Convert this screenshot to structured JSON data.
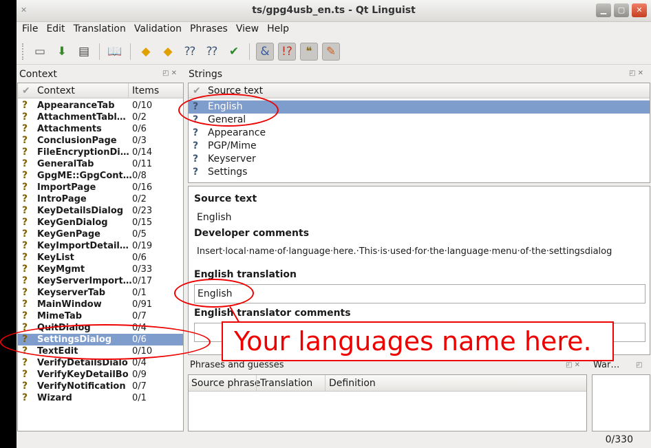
{
  "window": {
    "title": "ts/gpg4usb_en.ts - Qt Linguist",
    "buttons": [
      "▁",
      "▢",
      "✕"
    ]
  },
  "menu": [
    "File",
    "Edit",
    "Translation",
    "Validation",
    "Phrases",
    "View",
    "Help"
  ],
  "toolbar_icons": [
    "open-icon",
    "save-icon",
    "print-icon",
    "phrasebook-icon",
    "prev-icon",
    "next-icon",
    "prev-unfinished-icon",
    "next-unfinished-icon",
    "done-next-icon",
    "accelerator-check-icon",
    "punctuation-check-icon",
    "phrase-check-icon",
    "placemarker-check-icon"
  ],
  "context_panel": {
    "title": "Context",
    "col_context": "Context",
    "col_items": "Items",
    "rows": [
      {
        "name": "AppearanceTab",
        "items": "0/10"
      },
      {
        "name": "AttachmentTabl…",
        "items": "0/2"
      },
      {
        "name": "Attachments",
        "items": "0/6"
      },
      {
        "name": "ConclusionPage",
        "items": "0/3"
      },
      {
        "name": "FileEncryptionDi…",
        "items": "0/14"
      },
      {
        "name": "GeneralTab",
        "items": "0/11"
      },
      {
        "name": "GpgME::GpgCont…",
        "items": "0/8"
      },
      {
        "name": "ImportPage",
        "items": "0/16"
      },
      {
        "name": "IntroPage",
        "items": "0/2"
      },
      {
        "name": "KeyDetailsDialog",
        "items": "0/23"
      },
      {
        "name": "KeyGenDialog",
        "items": "0/15"
      },
      {
        "name": "KeyGenPage",
        "items": "0/5"
      },
      {
        "name": "KeyImportDetail…",
        "items": "0/19"
      },
      {
        "name": "KeyList",
        "items": "0/6"
      },
      {
        "name": "KeyMgmt",
        "items": "0/33"
      },
      {
        "name": "KeyServerImport…",
        "items": "0/17"
      },
      {
        "name": "KeyserverTab",
        "items": "0/1"
      },
      {
        "name": "MainWindow",
        "items": "0/91"
      },
      {
        "name": "MimeTab",
        "items": "0/7"
      },
      {
        "name": "QuitDialog",
        "items": "0/4"
      },
      {
        "name": "SettingsDialog",
        "items": "0/6"
      },
      {
        "name": "TextEdit",
        "items": "0/10"
      },
      {
        "name": "VerifyDetailsDialo",
        "items": "0/4"
      },
      {
        "name": "VerifyKeyDetailBo",
        "items": "0/9"
      },
      {
        "name": "VerifyNotification",
        "items": "0/7"
      },
      {
        "name": "Wizard",
        "items": "0/1"
      }
    ],
    "selected_index": 20
  },
  "strings_panel": {
    "title": "Strings",
    "col_source": "Source text",
    "rows": [
      "English",
      "General",
      "Appearance",
      "PGP/Mime",
      "Keyserver",
      "Settings"
    ],
    "selected_index": 0
  },
  "editor": {
    "source_label": "Source text",
    "source_value": "English",
    "dev_label": "Developer comments",
    "dev_value": "Insert·local·name·of·language·here.·This·is·used·for·the·language·menu·of·the·settingsdialog",
    "translation_label": "English translation",
    "translation_value": "English",
    "translator_label": "English translator comments"
  },
  "phrases_panel": {
    "title": "Phrases and guesses",
    "cols": [
      "Source phrase",
      "Translation",
      "Definition"
    ]
  },
  "warnings_panel": {
    "title": "War…"
  },
  "status": {
    "count": "0/330"
  },
  "annotation": {
    "text": "Your languages name here.",
    "color": "#e00000"
  }
}
